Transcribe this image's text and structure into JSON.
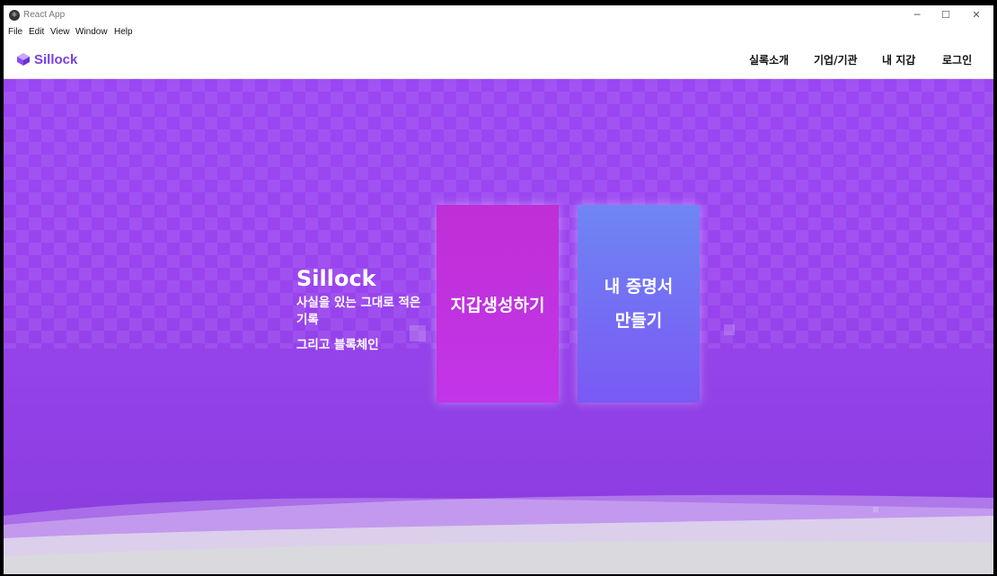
{
  "window": {
    "title": "React App",
    "controls": {
      "minimize": "─",
      "maximize": "☐",
      "close": "✕"
    }
  },
  "menu": [
    "File",
    "Edit",
    "View",
    "Window",
    "Help"
  ],
  "navbar": {
    "brand": "Sillock",
    "links": [
      "실록소개",
      "기업/기관",
      "내 지갑",
      "로그인"
    ]
  },
  "hero": {
    "title": "Sillock",
    "tagline_1": "사실을 있는 그대로 적은 기록",
    "tagline_2": "그리고 블록체인",
    "create_wallet_label": "지갑생성하기",
    "make_certificate_line1": "내 증명서",
    "make_certificate_line2": "만들기"
  },
  "colors": {
    "brand": "#7a3fe0",
    "hero_bg": "#9a47f3",
    "wallet_card": "#c235e8",
    "certificate_card": "#7366f4"
  }
}
